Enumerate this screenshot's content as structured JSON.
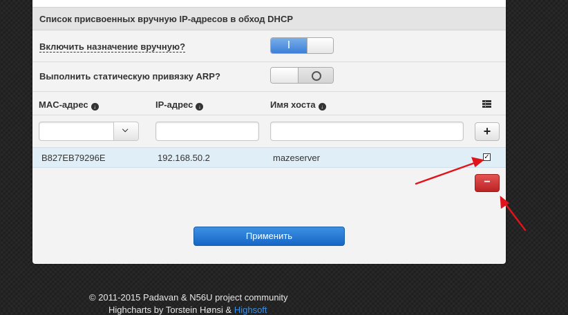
{
  "section": {
    "title": "Список присвоенных вручную IP-адресов в обход DHCP"
  },
  "settings": {
    "manual_assign": {
      "label": "Включить назначение вручную?",
      "state": "on",
      "on_glyph": "I"
    },
    "static_arp": {
      "label": "Выполнить статическую привязку ARP?",
      "state": "off",
      "off_glyph": "O"
    }
  },
  "table": {
    "columns": [
      "MAC-адрес",
      "IP-адрес",
      "Имя хоста"
    ],
    "sort_icon": "download-circle-icon",
    "list_icon": "list-icon",
    "inputs": {
      "mac": "",
      "ip": "",
      "hostname": ""
    },
    "add_glyph": "+",
    "rows": [
      {
        "mac": "B827EB79296E",
        "ip": "192.168.50.2",
        "hostname": "mazeserver",
        "checked": true,
        "check_glyph": "✓"
      }
    ],
    "delete_glyph": "−"
  },
  "apply_button": "Применить",
  "footer": {
    "line1": "© 2011-2015 Padavan & N56U project community",
    "line2_prefix": "Highcharts by Torstein Hønsi & ",
    "line2_link": "Highsoft"
  },
  "colors": {
    "accent_blue": "#1766c5",
    "danger_red": "#bb2323",
    "annotation_red": "#e0141a",
    "row_highlight": "#dfeef7"
  }
}
